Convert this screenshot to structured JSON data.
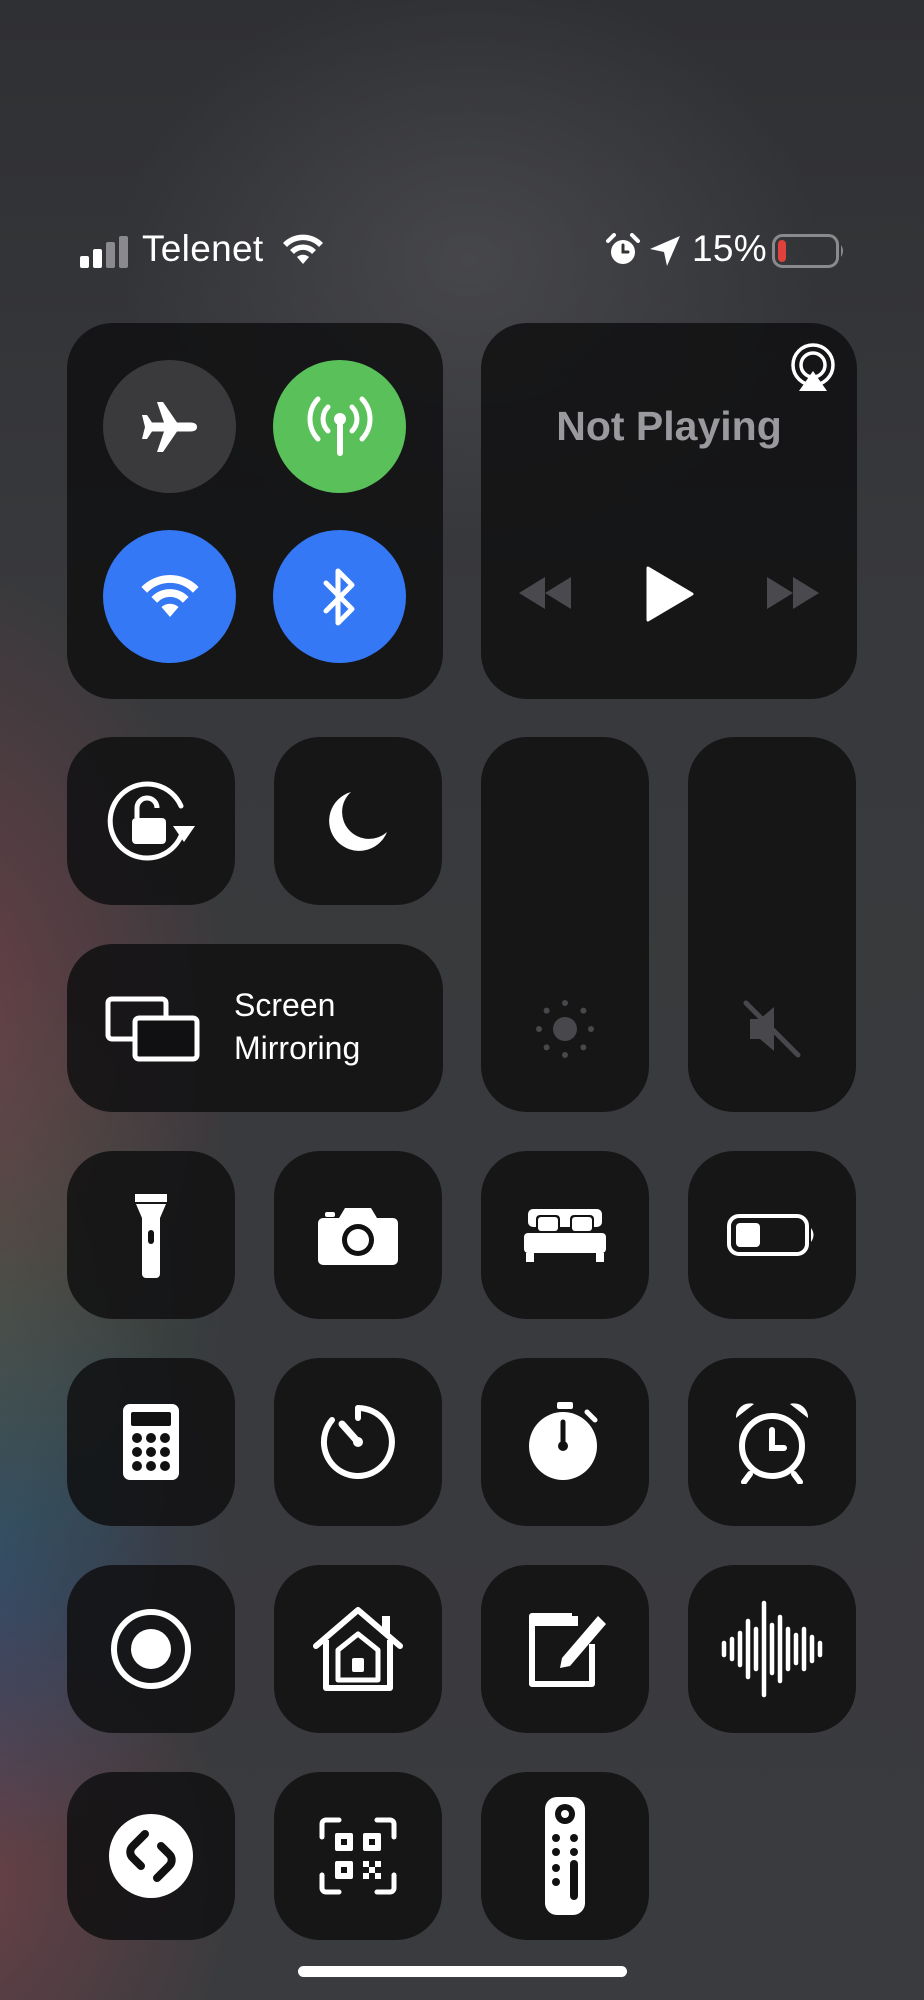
{
  "status_bar": {
    "carrier": "Telenet",
    "battery_percent": "15%",
    "battery_level": 0.15,
    "icons": [
      "signal-bars-icon",
      "wifi-icon",
      "alarm-icon",
      "location-arrow-icon",
      "battery-icon"
    ]
  },
  "connectivity": {
    "airplane_mode": {
      "icon": "airplane-icon",
      "on": false,
      "color": "#3a3a3c"
    },
    "cellular_data": {
      "icon": "antenna-icon",
      "on": true,
      "color": "#5ac15a"
    },
    "wifi": {
      "icon": "wifi-icon",
      "on": true,
      "color": "#3478f6"
    },
    "bluetooth": {
      "icon": "bluetooth-icon",
      "on": true,
      "color": "#3478f6"
    }
  },
  "now_playing": {
    "title": "Not Playing",
    "controls": [
      "rewind-icon",
      "play-icon",
      "fast-forward-icon"
    ],
    "airplay_icon": "airplay-icon"
  },
  "screen_mirroring": {
    "label_line1": "Screen",
    "label_line2": "Mirroring"
  },
  "sliders": {
    "brightness": {
      "icon": "sun-icon",
      "level": 0
    },
    "volume": {
      "icon": "speaker-muted-icon",
      "level": 0
    }
  },
  "controls": [
    "orientation-lock-icon",
    "moon-icon",
    "flashlight-icon",
    "camera-icon",
    "bed-icon",
    "battery-icon",
    "calculator-icon",
    "timer-icon",
    "stopwatch-icon",
    "alarm-clock-icon",
    "screen-record-icon",
    "home-icon",
    "notes-icon",
    "voice-memo-icon",
    "shazam-icon",
    "qr-code-icon",
    "remote-icon"
  ],
  "colors": {
    "tile": "#111113",
    "active_green": "#5ac15a",
    "active_blue": "#3478f6",
    "battery_low": "#e0413a"
  }
}
